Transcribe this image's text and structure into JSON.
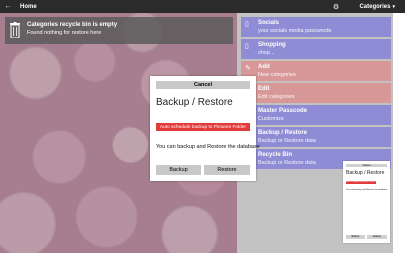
{
  "titlebar": {
    "title": "Home",
    "right_label": "Categories"
  },
  "banner": {
    "title": "Categories recycle bin is empty",
    "subtitle": "Found nothing for restore here"
  },
  "tiles": [
    {
      "title": "Socials",
      "subtitle": "your socials media passwords",
      "color": "#8e8cd4"
    },
    {
      "title": "Shopping",
      "subtitle": "shop...",
      "color": "#8e8cd4"
    },
    {
      "title": "Add",
      "subtitle": "New categories",
      "color": "#d99898"
    },
    {
      "title": "Edit",
      "subtitle": "Edit categories",
      "color": "#d99898"
    },
    {
      "title": "Master Passcode",
      "subtitle": "Customize",
      "color": "#8e8cd4"
    },
    {
      "title": "Backup / Restore",
      "subtitle": "Backup or Restore data",
      "color": "#8e8cd4"
    },
    {
      "title": "Recycle Bin",
      "subtitle": "Backup or Restore data",
      "color": "#8e8cd4"
    }
  ],
  "dialog": {
    "cancel_label": "Cancel",
    "title": "Backup /  Restore",
    "auto_schedule_label": "Auto schedule backup to Pictures Folder",
    "description": "You can backup and Restore the database",
    "backup_label": "Backup",
    "restore_label": "Restore"
  },
  "preview": {
    "cancel_label": "Cancel",
    "title": "Backup /  Restore",
    "auto_schedule_label": "Auto schedule backup to Pictures Folder",
    "description": "You can backup and Restore the database",
    "backup_label": "Backup",
    "restore_label": "Restore"
  }
}
